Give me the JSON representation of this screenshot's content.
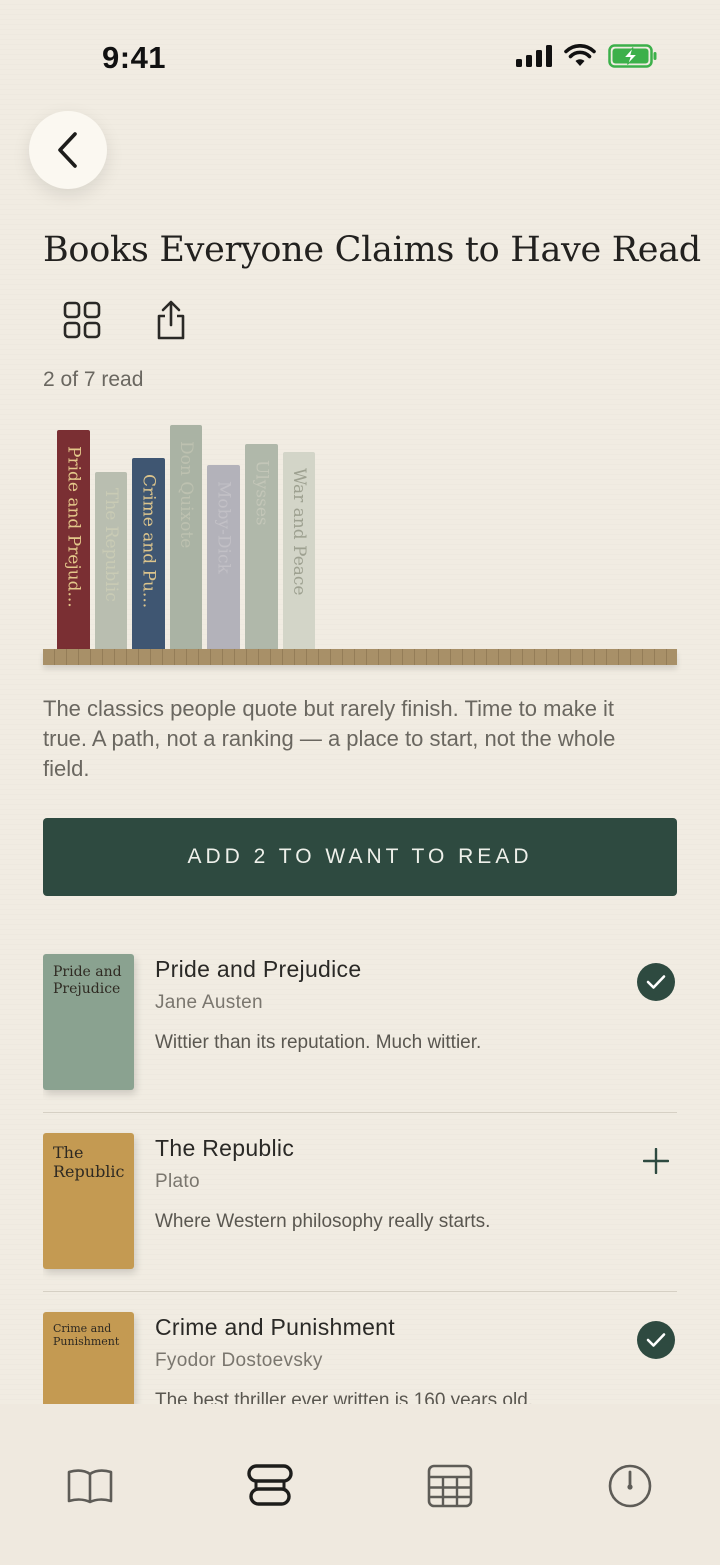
{
  "status_bar": {
    "time": "9:41"
  },
  "header": {
    "title": "Books Everyone Claims to Have Read"
  },
  "toolbar": {
    "grid_icon": "grid-icon",
    "share_icon": "share-icon"
  },
  "progress": {
    "text": "2 of 7 read",
    "read": 2,
    "total": 7
  },
  "shelf": {
    "spines": [
      {
        "label": "Pride and Prejud...",
        "color": "#7a2f33",
        "text_color": "#e3c78a",
        "read": true
      },
      {
        "label": "The Republic",
        "color": "#b9beb0",
        "text_color": "#c9cbb5",
        "read": false
      },
      {
        "label": "Crime and Pu...",
        "color": "#3f5672",
        "text_color": "#dcc48c",
        "read": true
      },
      {
        "label": "Don Quixote",
        "color": "#aab3a4",
        "text_color": "#bdc1b0",
        "read": false
      },
      {
        "label": "Moby-Dick",
        "color": "#b3b2ba",
        "text_color": "#c2c0c6",
        "read": false
      },
      {
        "label": "Ulysses",
        "color": "#b0b8aa",
        "text_color": "#c3c6b8",
        "read": false
      },
      {
        "label": "War and Peace",
        "color": "#d3d5c8",
        "text_color": "#9ea191",
        "read": false
      }
    ]
  },
  "description": "The classics people quote but rarely finish. Time to make it true. A path, not a ranking — a place to start, not the whole field.",
  "cta": {
    "label": "ADD 2 TO WANT TO READ"
  },
  "books": [
    {
      "cover_title": "Pride and Prejudice",
      "cover_color": "#8aa290",
      "title": "Pride and Prejudice",
      "author": "Jane Austen",
      "note": "Wittier than its reputation. Much wittier.",
      "status": "read"
    },
    {
      "cover_title": "The Republic",
      "cover_color": "#c49a52",
      "title": "The Republic",
      "author": "Plato",
      "note": "Where Western philosophy really starts.",
      "status": "add"
    },
    {
      "cover_title": "Crime and Punishment",
      "cover_color": "#c49a52",
      "title": "Crime and Punishment",
      "author": "Fyodor Dostoevsky",
      "note": "The best thriller ever written is 160 years old.",
      "status": "read"
    }
  ],
  "tabs": [
    {
      "name": "book-icon",
      "active": false
    },
    {
      "name": "stack-icon",
      "active": true
    },
    {
      "name": "table-icon",
      "active": false
    },
    {
      "name": "gauge-icon",
      "active": false
    }
  ]
}
